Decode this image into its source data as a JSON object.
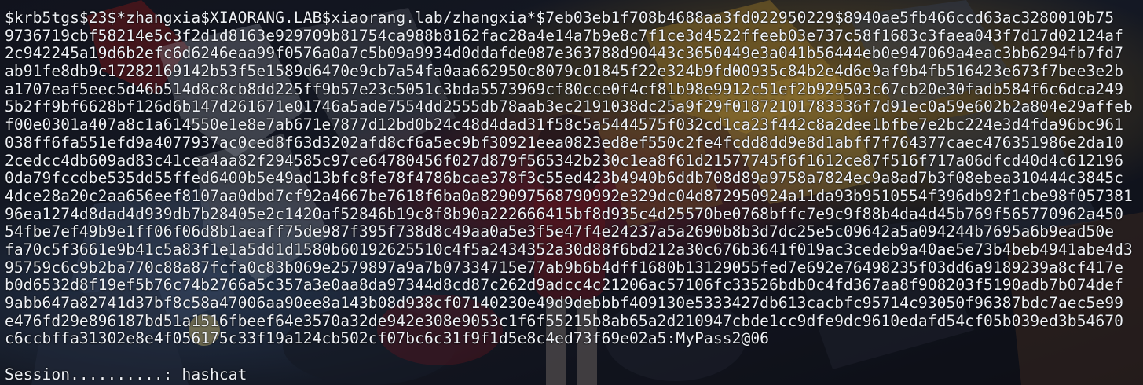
{
  "hash_output": {
    "lines": [
      "$krb5tgs$23$*zhangxia$XIAORANG.LAB$xiaorang.lab/zhangxia*$7eb03eb1f708b4688aa3fd022950229$8940ae5fb466ccd63ac3280010b75",
      "9736719cbf58214e5c3f2d1d8163e929709b81754ca988b8162fac28a4e14a7b9e8c7f1ce3d4522ffeeb03e737c58f1683c3faea043f7d17d02124af",
      "2c942245a19d6b2efc6d6246eaa99f0576a0a7c5b09a9934d0ddafde087e363788d90443c3650449e3a041b56444eb0e947069a4eac3bb6294fb7fd7",
      "ab91fe8db9c17282169142b53f5e1589d6470e9cb7a54fa0aa662950c8079c01845f22e324b9fd00935c84b2e4d6e9af9b4fb516423e673f7bee3e2b",
      "a1707eaf5eec5d46b514d8c8cb8dd225ff9b57e23c5051c3bda5573969cf80cce0f4cf81b98e9912c51ef2b929503c67cb20e30fadb584f6c6dca249",
      "5b2ff9bf6628bf126d6b147d261671e01746a5ade7554dd2555db78aab3ec2191038dc25a9f29f01872101783336f7d91ec0a59e602b2a804e29affeb",
      "f00e0301a407a8c1a614550e1e8e7ab671e7877d12bd0b24c48d4dad31f58c5a5444575f032cd1ca23f442c8a2dee1bfbe7e2bc224e3d4fda96bc961",
      "038ff6fa551efd9a4077937ac0ced8f63d3202afd8cf6a5ec9bf30921eea0823ed8ef550c2fe4fcdd8dd9e8d1abff7f764377caec476351986e2da10",
      "2cedcc4db609ad83c41cea4aa82f294585c97ce64780456f027d879f565342b230c1ea8f61d21577745f6f1612ce87f516f717a06dfcd40d4c612196",
      "0da79fccdbe535dd55ffed6400b5e49ad13bfc8fe78f4786bcae378f3c55ed423b4940b6ddb708d89a9758a7824ec9a8ad7b3f08ebea310444c3845c",
      "4dce28a20c2aa656eef8107aa0dbd7cf92a4667be7618f6ba0a829097568790992e329dc04d872950924a11da93b9510554f396db92f1cbe98f057381",
      "96ea1274d8dad4d939db7b28405e2c1420af52846b19c8f8b90a222666415bf8d935c4d25570be0768bffc7e9c9f88b4da4d45b769f565770962a450",
      "54fbe7ef49b9e1ff06f06d8b1aeaff75de987f395f738d8c49aa0a5e3f5e47f4e24237a5a2690b8b3d7dc25e5c09642a5a094244b7695a6b9ead50e",
      "fa70c5f3661e9b41c5a83f1e1a5dd1d1580b60192625510c4f5a2434352a30d88f6bd212a30c676b3641f019ac3cedeb9a40ae5e73b4beb4941abe4d3",
      "95759c6c9b2ba770c88a87fcfa0c83b069e2579897a9a7b07334715e77ab9b6b4dff1680b13129055fed7e692e76498235f03dd6a9189239a8cf417e",
      "b0d6532d8f19ef5b76c74b2766a5c357a3e0aa8da97344d8cd87c262d9adcc4c21206ac57106fc33526bdb0c4fd367aa8f908203f5190adb7b074def",
      "9abb647a82741d37bf8c58a47006aa90ee8a143b08d938cf07140230e49d9debbbf409130e5333427db613cacbfc95714c93050f96387bdc7aec5e99",
      "e476fd29e896187bd51a1516fbeef64e3570a32de942e308e9053c1f6f55215b8ab65a2d210947cbde1cc9dfe9dc9610edafd54cf05b039ed3b54670",
      "c6ccbffa31302e8e4f056175c33f19a124cb502cf07bc6c31f9f1d5e8c4ed73f69e02a5:MyPass2@06"
    ],
    "status_line": "Session..........: hashcat"
  },
  "colors": {
    "text": "#eef1f6",
    "background": "#10131b"
  }
}
